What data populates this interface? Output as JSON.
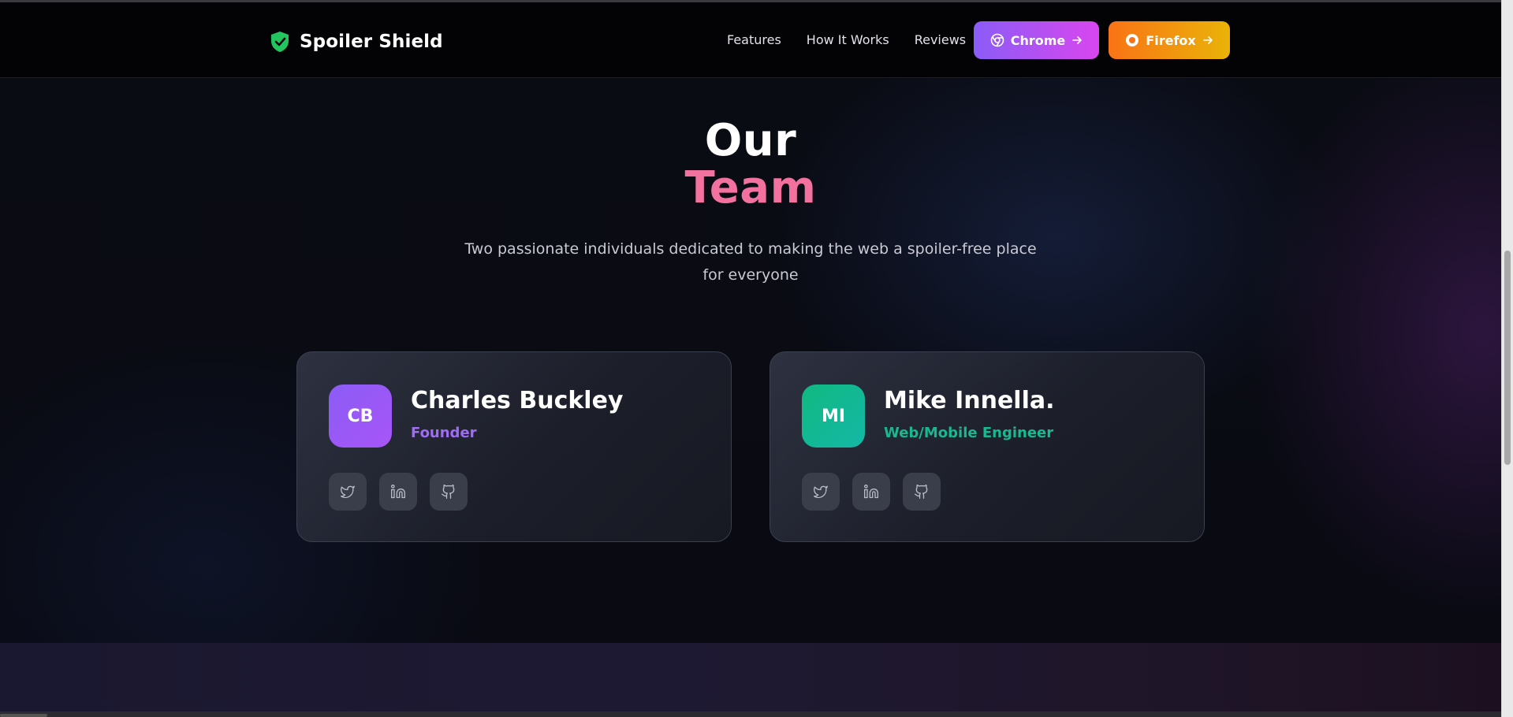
{
  "brand": {
    "name": "Spoiler Shield",
    "icon": "shield-check-icon",
    "icon_color": "#22c55e"
  },
  "nav": {
    "links": [
      "Features",
      "How It Works",
      "Reviews"
    ],
    "chrome_button": {
      "label": "Chrome",
      "icon": "chrome-icon",
      "arrow": "arrow-right-icon"
    },
    "firefox_button": {
      "label": "Firefox",
      "icon": "firefox-icon",
      "arrow": "arrow-right-icon"
    }
  },
  "hero": {
    "title_line1": "Our",
    "title_line2": "Team",
    "subtitle": "Two passionate individuals dedicated to making the web a spoiler-free place for everyone"
  },
  "team": [
    {
      "initials": "CB",
      "name": "Charles Buckley",
      "role": "Founder",
      "accent": "#8b5cf6",
      "socials": [
        "twitter-icon",
        "linkedin-icon",
        "github-icon"
      ]
    },
    {
      "initials": "MI",
      "name": "Mike Innella.",
      "role": "Web/Mobile Engineer",
      "accent": "#10b981",
      "socials": [
        "twitter-icon",
        "linkedin-icon",
        "github-icon"
      ]
    }
  ],
  "colors": {
    "title_accent": "#f2719e",
    "background": "#0a0c14",
    "chrome_gradient": [
      "#8b5cf6",
      "#d946ef"
    ],
    "firefox_gradient": [
      "#f97316",
      "#eab308"
    ]
  }
}
